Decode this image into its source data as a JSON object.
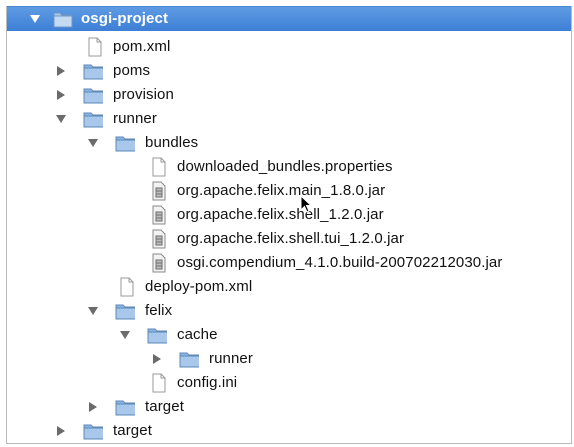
{
  "tree": {
    "colors": {
      "selection": "#3d7fd6",
      "folder": "#8db5e0",
      "disclosure": "#6b6b6b"
    },
    "rows": [
      {
        "label": "osgi-project",
        "icon": "folder-icon",
        "disclosure": "expanded",
        "selected": true
      },
      {
        "label": "pom.xml",
        "icon": "file-icon",
        "disclosure": "none"
      },
      {
        "label": "poms",
        "icon": "folder-icon",
        "disclosure": "collapsed"
      },
      {
        "label": "provision",
        "icon": "folder-icon",
        "disclosure": "collapsed"
      },
      {
        "label": "runner",
        "icon": "folder-icon",
        "disclosure": "expanded"
      },
      {
        "label": "bundles",
        "icon": "folder-icon",
        "disclosure": "expanded"
      },
      {
        "label": "downloaded_bundles.properties",
        "icon": "file-icon",
        "disclosure": "none"
      },
      {
        "label": "org.apache.felix.main_1.8.0.jar",
        "icon": "jar-icon",
        "disclosure": "none"
      },
      {
        "label": "org.apache.felix.shell_1.2.0.jar",
        "icon": "jar-icon",
        "disclosure": "none"
      },
      {
        "label": "org.apache.felix.shell.tui_1.2.0.jar",
        "icon": "jar-icon",
        "disclosure": "none"
      },
      {
        "label": "osgi.compendium_4.1.0.build-200702212030.jar",
        "icon": "jar-icon",
        "disclosure": "none"
      },
      {
        "label": "deploy-pom.xml",
        "icon": "file-icon",
        "disclosure": "none"
      },
      {
        "label": "felix",
        "icon": "folder-icon",
        "disclosure": "expanded"
      },
      {
        "label": "cache",
        "icon": "folder-icon",
        "disclosure": "expanded"
      },
      {
        "label": "runner",
        "icon": "folder-icon",
        "disclosure": "collapsed"
      },
      {
        "label": "config.ini",
        "icon": "file-icon",
        "disclosure": "none"
      },
      {
        "label": "target",
        "icon": "folder-icon",
        "disclosure": "collapsed"
      },
      {
        "label": "target",
        "icon": "folder-icon",
        "disclosure": "collapsed"
      }
    ]
  },
  "cursor": {
    "icon": "mouse-pointer-icon"
  }
}
